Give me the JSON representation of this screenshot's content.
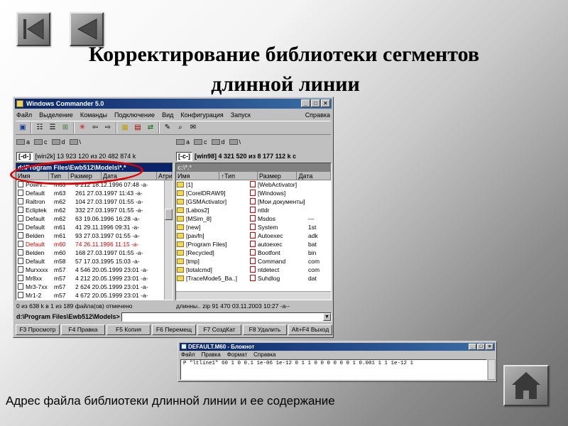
{
  "slide": {
    "title_line1": "Корректирование  библиотеки сегментов",
    "title_line2": "длинной линии",
    "caption": "Адрес файла библиотеки  длинной  линии  и ее содержание",
    "nav": {
      "first_icon": "first-slide-icon",
      "prev_icon": "prev-slide-icon",
      "home_icon": "home-icon"
    }
  },
  "wc": {
    "title": "Windows Commander 5.0",
    "menu": [
      "Файл",
      "Выделение",
      "Команды",
      "Подключение",
      "Вид",
      "Конфигурация",
      "Запуск"
    ],
    "menu_right": "Справка",
    "left_drives": [
      "a",
      "c",
      "d",
      "\\"
    ],
    "right_drives": [
      "a",
      "c",
      "d",
      "\\"
    ],
    "left_drive_combo": "[-d-]",
    "left_drive_info": "[win2k]  13 923 120 из 20 482 874 k",
    "right_drive_combo": "[-c-]",
    "right_drive_info": "[win98]  4 321 520 из 8 177 112 k c",
    "left_path": "d:\\Program Files\\Ewb512\\Models\\*.*",
    "right_path": "c:\\*.*",
    "left_headers": [
      "Имя",
      "Тип",
      "Размер",
      "Дата",
      "Атри"
    ],
    "right_headers": [
      "Имя",
      "↑Тип",
      "Размер",
      "Дата"
    ],
    "left_rows": [
      {
        "name": "Powrv...",
        "type": "m63",
        "rest": "8 212 18.12.1996 07:48 -a-"
      },
      {
        "name": "Default",
        "type": "m63",
        "rest": "261 27.03.1997 11:43 -a-"
      },
      {
        "name": "Raltron",
        "type": "m62",
        "rest": "104 27.03.1997 01:55 -a-"
      },
      {
        "name": "Ecliptek",
        "type": "m62",
        "rest": "332 27.03.1997 01:55 -a-"
      },
      {
        "name": "Default",
        "type": "m62",
        "rest": "63 19.06.1996 16:28 -a-"
      },
      {
        "name": "Default",
        "type": "m61",
        "rest": "41 29.11.1996 09:31 -a-"
      },
      {
        "name": "Belden",
        "type": "m61",
        "rest": "93 27.03.1997 01:55 -a-"
      },
      {
        "name": "Default",
        "type": "m60",
        "rest": "74 26.11.1996 11:15 -a-"
      },
      {
        "name": "Belden",
        "type": "m60",
        "rest": "168 27.03.1997 01:55 -a-"
      },
      {
        "name": "Default",
        "type": "m58",
        "rest": "57 17.03.1995 15:03 -a-"
      },
      {
        "name": "Murxxxx",
        "type": "m57",
        "rest": "4 546 20.05.1999 23:01 -a-"
      },
      {
        "name": "Mr8xx",
        "type": "m57",
        "rest": "4 212 20.05.1999 23:01 -a-"
      },
      {
        "name": "Mr3-7xx",
        "type": "m57",
        "rest": "2 624 20.05.1999 23:01 -a-"
      },
      {
        "name": "Mr1-2",
        "type": "m57",
        "rest": "4 672 20.05.1999 23:01 -a-"
      }
    ],
    "right_col1": [
      "[1]",
      "[CorelDRAW9]",
      "[GSMActivator]",
      "[Labos2]",
      "[MSim_8]",
      "[new]",
      "[pavfn]",
      "[Program Files]",
      "[Recycled]",
      "[tmp]",
      "[totalcmd]",
      "[TraceMode5_Ba..]"
    ],
    "right_col2": [
      "[WebActivator]",
      "[Windows]",
      "[Мои документы]",
      "ntldr",
      "Msdos",
      "System",
      "Autoexec",
      "autoexec",
      "Bootfont",
      "Command",
      "ntdetect",
      "Suhdlog"
    ],
    "right_col3": [
      "",
      "",
      "",
      "",
      "---",
      "1st",
      "adk",
      "bat",
      "bin",
      "com",
      "com",
      "dat"
    ],
    "left_status": "0 из 638 k в 1 из 189 файла(ов) отмечено",
    "right_status": "длинны..  zip     91 470 03.11.2003 10:27 -a--",
    "cmd_prefix": "d:\\Program Files\\Ewb512\\Models>",
    "fkeys": [
      "F3 Просмотр",
      "F4 Правка",
      "F5 Копия",
      "F6 Перемещ",
      "F7 СоздКат",
      "F8 Удалить",
      "Alt+F4 Выход"
    ]
  },
  "notepad": {
    "title": "DEFAULT.M60 - Блокнот",
    "menu": [
      "Файл",
      "Правка",
      "Формат",
      "Справка"
    ],
    "content": "P  \"ltline1\"  60 1 0 0.1 1e-06 1e-12 0 1 1 0 0 0 0 0 0 1 0.001 1 1 1e-12 1"
  }
}
